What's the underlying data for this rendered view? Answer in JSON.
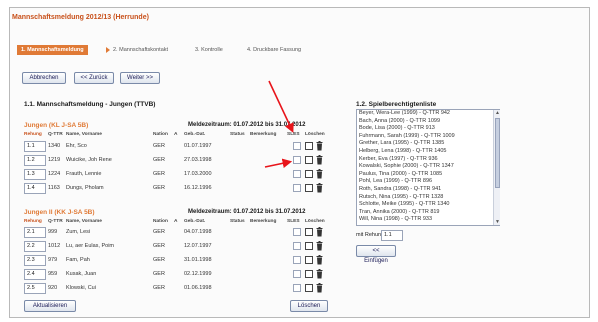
{
  "page": {
    "title": "Mannschaftsmeldung 2012/13 (Herrunde)"
  },
  "steps": [
    {
      "label": "1. Mannschaftsmeldung",
      "active": true
    },
    {
      "label": "2. Mannschaftskontakt"
    },
    {
      "label": "3. Kontrolle"
    },
    {
      "label": "4. Druckbare Fassung"
    }
  ],
  "toolbar": {
    "cancel_label": "Abbrechen",
    "back_label": "<< Zurück",
    "next_label": "Weiter >>"
  },
  "left": {
    "section_title": "1.1. Mannschaftsmeldung - Jungen (TTVB)",
    "columns": {
      "rank": "Rehung",
      "qttr": "Q-TTR",
      "name": "Name, Vorname",
      "nation": "Nation",
      "a": "A",
      "birth": "Geb.-Dat.",
      "status": "Status",
      "remark": "Bemerkung",
      "sles": "SLES",
      "delete": "Löschen"
    },
    "teams": [
      {
        "name": "Jungen (KL J-SA 5B)",
        "meldezeitraum": "Meldezeitraum: 01.07.2012 bis 31.07.2012",
        "rows": [
          {
            "rank": "1.1",
            "qttr": "1340",
            "name": "Ehr, Sco",
            "nation": "GER",
            "birth": "01.07.1997"
          },
          {
            "rank": "1.2",
            "qttr": "1219",
            "name": "Wuicike, Joh Rene",
            "nation": "GER",
            "birth": "27.03.1998"
          },
          {
            "rank": "1.3",
            "qttr": "1224",
            "name": "Frauth, Lennie",
            "nation": "GER",
            "birth": "17.03.2000"
          },
          {
            "rank": "1.4",
            "qttr": "1163",
            "name": "Dungs, Pholam",
            "nation": "GER",
            "birth": "16.12.1996"
          }
        ]
      },
      {
        "name": "Jungen II (KK J-SA 5B)",
        "meldezeitraum": "Meldezeitraum: 01.07.2012 bis 31.07.2012",
        "rows": [
          {
            "rank": "2.1",
            "qttr": "999",
            "name": "Zum, Lesi",
            "nation": "GER",
            "birth": "04.07.1998"
          },
          {
            "rank": "2.2",
            "qttr": "1012",
            "name": "Lu, aer Eulas, Poim",
            "nation": "GER",
            "birth": "12.07.1997"
          },
          {
            "rank": "2.3",
            "qttr": "979",
            "name": "Fam, Pah",
            "nation": "GER",
            "birth": "31.01.1998"
          },
          {
            "rank": "2.4",
            "qttr": "959",
            "name": "Kusak, Juan",
            "nation": "GER",
            "birth": "02.12.1999"
          },
          {
            "rank": "2.5",
            "qttr": "920",
            "name": "Klowski, Cui",
            "nation": "GER",
            "birth": "01.06.1998"
          }
        ]
      }
    ],
    "refresh_label": "Aktualisieren",
    "delete_label": "Löschen"
  },
  "right": {
    "section_title": "1.2. Spielberechtigtenliste",
    "players": [
      "Beyer, Wera-Lee (1999) - Q-TTR 942",
      "Bach, Anna (2000) - Q-TTR 1099",
      "Bode, Lisa (2000) - Q-TTR 913",
      "Fuhrmann, Sarah (1999) - Q-TTR 1009",
      "Grether, Lara (1995) - Q-TTR 1385",
      "Helberg, Lena (1998) - Q-TTR 1405",
      "Kerber, Eva (1997) - Q-TTR 936",
      "Kowalski, Sophie (2000) - Q-TTR 1347",
      "Paulus, Tina (2000) - Q-TTR 1085",
      "Pohl, Lea (1999) - Q-TTR 896",
      "Roth, Sandra (1998) - Q-TTR 941",
      "Rutsch, Nina (1995) - Q-TTR 1328",
      "Schlotte, Meike (1995) - Q-TTR 1340",
      "Tran, Annika (2000) - Q-TTR 819",
      "Will, Nina (1998) - Q-TTR 933"
    ],
    "rank_label": "mit Rehung",
    "rank_value": "1.1",
    "insert_label": "<< Einfügen"
  },
  "colors": {
    "accent": "#e07a36",
    "title": "#c8501a",
    "annotation_arrow": "#e8141a"
  }
}
